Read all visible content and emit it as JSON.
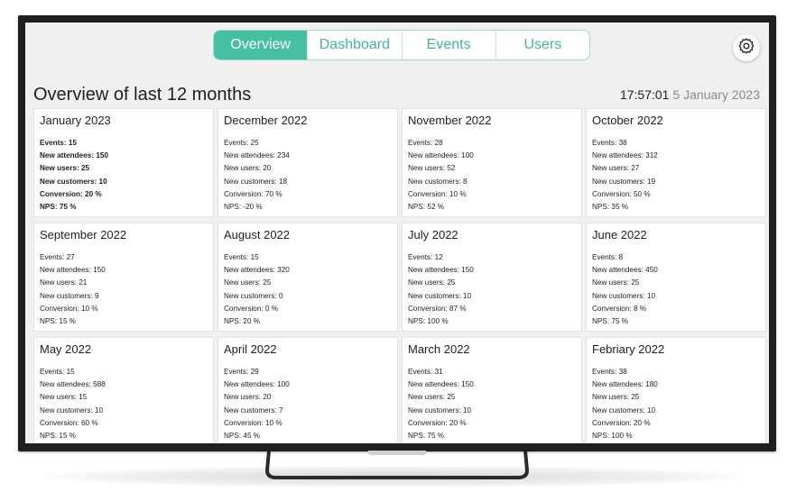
{
  "tabs": [
    {
      "label": "Overview",
      "active": true
    },
    {
      "label": "Dashboard",
      "active": false
    },
    {
      "label": "Events",
      "active": false
    },
    {
      "label": "Users",
      "active": false
    }
  ],
  "settings_icon": "gear-icon",
  "page_title": "Overview of last 12 months",
  "clock": {
    "time": "17:57:01",
    "date": "5 January 2023"
  },
  "colors": {
    "accent": "#45c0a2",
    "accent_text": "#3fb79c",
    "background": "#f0f0f0",
    "bezel": "#1d1f21"
  },
  "months": [
    {
      "title": "January 2023",
      "highlighted": true,
      "stats": [
        "Events: 15",
        "New attendees: 150",
        "New users: 25",
        "New customers: 10",
        "Conversion: 20 %",
        "NPS: 75 %"
      ]
    },
    {
      "title": "December 2022",
      "highlighted": false,
      "stats": [
        "Events: 25",
        "New attendees: 234",
        "New users: 20",
        "New customers: 18",
        "Conversion: 70 %",
        "NPS: -20 %"
      ]
    },
    {
      "title": "November 2022",
      "highlighted": false,
      "stats": [
        "Events: 28",
        "New attendees: 100",
        "New users: 52",
        "New customers: 8",
        "Conversion: 10 %",
        "NPS: 52 %"
      ]
    },
    {
      "title": "October 2022",
      "highlighted": false,
      "stats": [
        "Events: 38",
        "New attendees: 312",
        "New users: 27",
        "New customers: 19",
        "Conversion: 50 %",
        "NPS: 35 %"
      ]
    },
    {
      "title": "September 2022",
      "highlighted": false,
      "stats": [
        "Events: 27",
        "New attendees: 150",
        "New users: 21",
        "New customers: 9",
        "Conversion: 10 %",
        "NPS: 15 %"
      ]
    },
    {
      "title": "August 2022",
      "highlighted": false,
      "stats": [
        "Events: 15",
        "New attendees: 320",
        "New users: 25",
        "New customers: 0",
        "Conversion: 0 %",
        "NPS: 20 %"
      ]
    },
    {
      "title": "July 2022",
      "highlighted": false,
      "stats": [
        "Events: 12",
        "New attendees: 150",
        "New users: 25",
        "New customers: 10",
        "Conversion: 87 %",
        "NPS: 100 %"
      ]
    },
    {
      "title": "June 2022",
      "highlighted": false,
      "stats": [
        "Events: 8",
        "New attendees: 450",
        "New users: 25",
        "New customers: 10",
        "Conversion: 8 %",
        "NPS: 75 %"
      ]
    },
    {
      "title": "May 2022",
      "highlighted": false,
      "stats": [
        "Events: 15",
        "New attendees: 588",
        "New users: 15",
        "New customers: 10",
        "Conversion: 60 %",
        "NPS: 15 %"
      ]
    },
    {
      "title": "April 2022",
      "highlighted": false,
      "stats": [
        "Events: 29",
        "New attendees: 100",
        "New users: 20",
        "New customers: 7",
        "Conversion: 10 %",
        "NPS: 45 %"
      ]
    },
    {
      "title": "March 2022",
      "highlighted": false,
      "stats": [
        "Events: 31",
        "New attendees: 150",
        "New users: 25",
        "New customers: 10",
        "Conversion: 20 %",
        "NPS: 75 %"
      ]
    },
    {
      "title": "Febriary 2022",
      "highlighted": false,
      "stats": [
        "Events: 38",
        "New attendees: 180",
        "New users: 25",
        "New customers: 10",
        "Conversion: 20 %",
        "NPS: 100 %"
      ]
    }
  ]
}
